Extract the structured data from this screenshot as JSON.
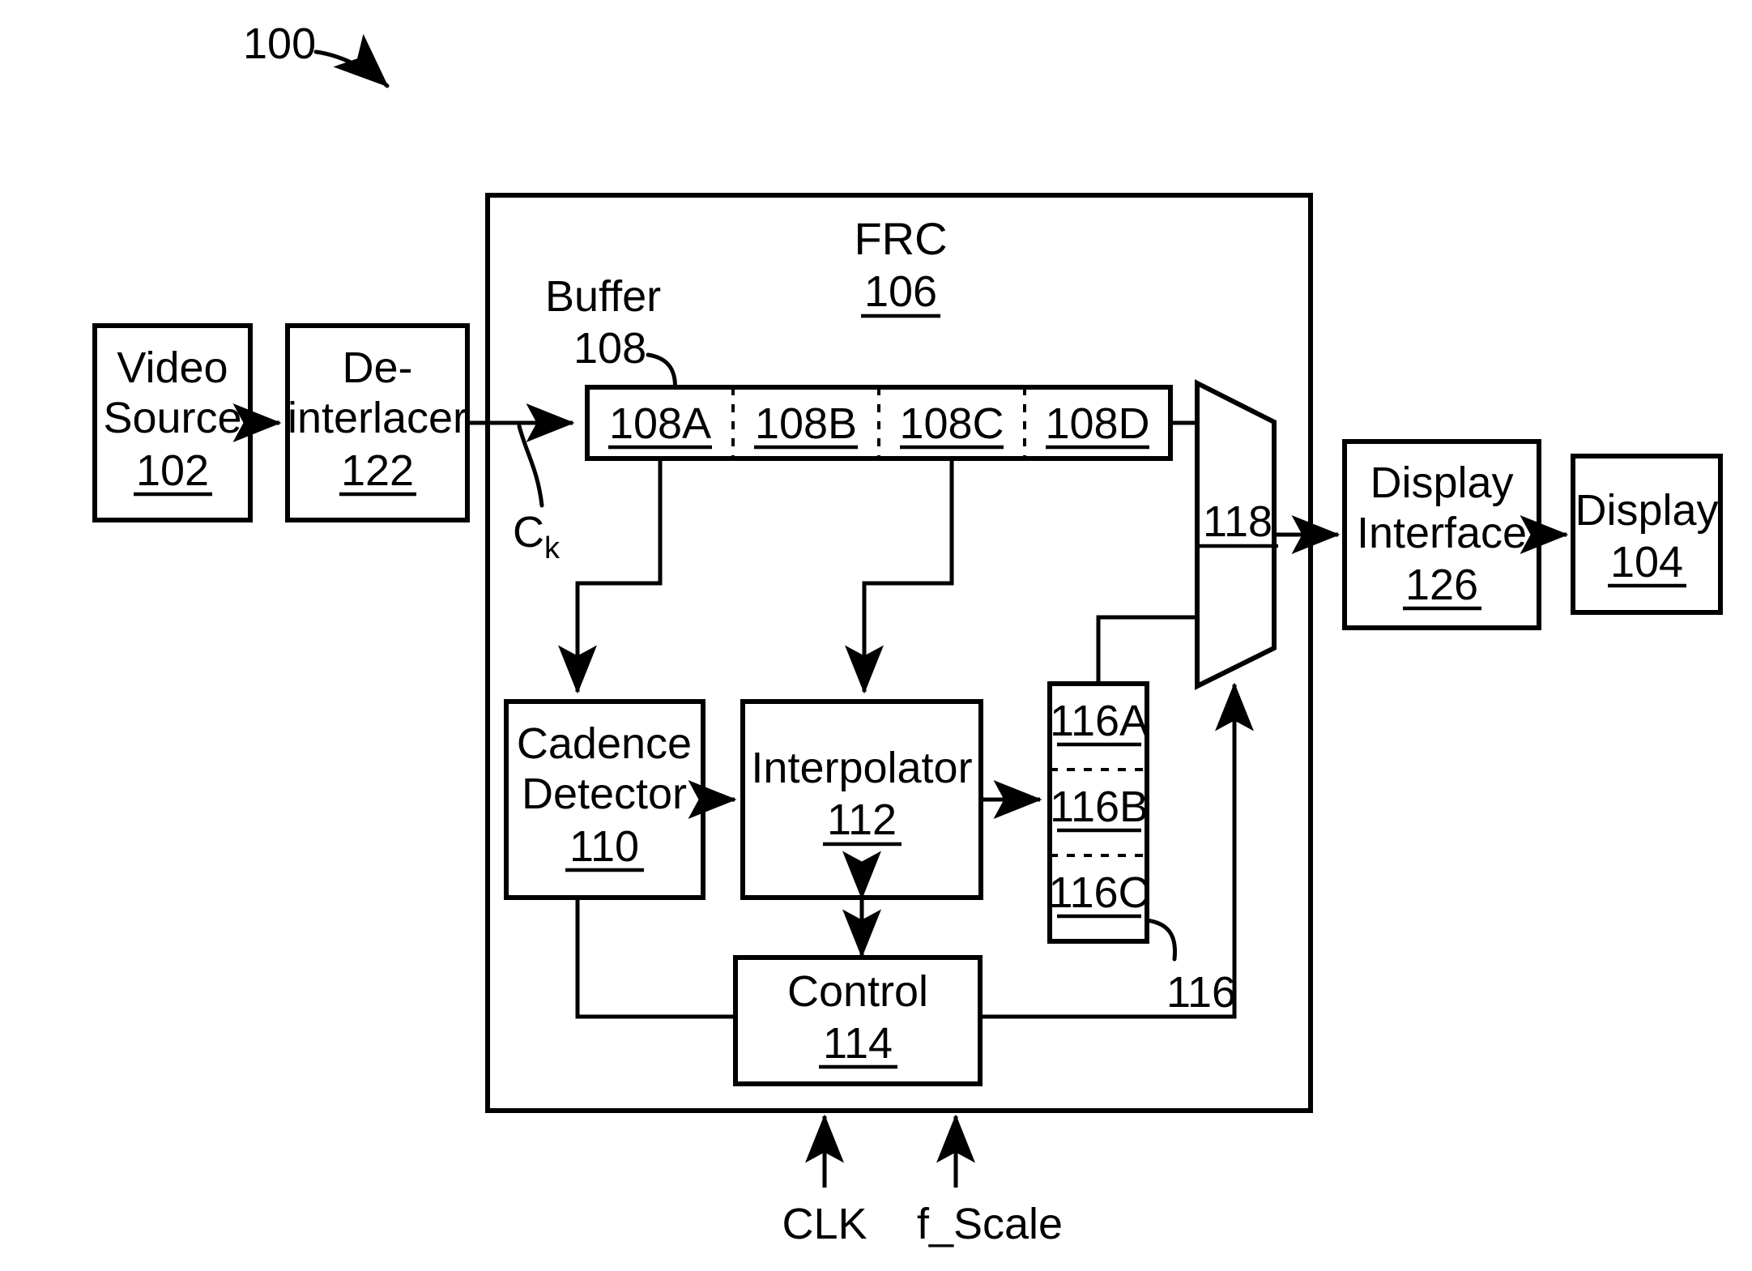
{
  "figure": {
    "figure_ref": "100",
    "title_note": "Frame rate converter block diagram"
  },
  "blocks": {
    "video_source": {
      "name": "video-source",
      "line1": "Video",
      "line2": "Source",
      "ref": "102"
    },
    "deinterlacer": {
      "name": "de-interlacer",
      "line1": "De-",
      "line2": "interlacer",
      "ref": "122"
    },
    "frc": {
      "name": "frc",
      "label": "FRC",
      "ref": "106"
    },
    "buffer": {
      "name": "buffer",
      "label": "Buffer",
      "ref": "108",
      "cells": [
        {
          "ref": "108A"
        },
        {
          "ref": "108B"
        },
        {
          "ref": "108C"
        },
        {
          "ref": "108D"
        }
      ]
    },
    "cadence_detector": {
      "name": "cadence-detector",
      "line1": "Cadence",
      "line2": "Detector",
      "ref": "110"
    },
    "interpolator": {
      "name": "interpolator",
      "label": "Interpolator",
      "ref": "112"
    },
    "control": {
      "name": "control",
      "label": "Control",
      "ref": "114"
    },
    "frame_store": {
      "name": "frame-store",
      "ref": "116",
      "cells": [
        {
          "ref": "116A"
        },
        {
          "ref": "116B"
        },
        {
          "ref": "116C"
        }
      ]
    },
    "mux": {
      "name": "mux",
      "ref": "118"
    },
    "display_interface": {
      "name": "display-interface",
      "line1": "Display",
      "line2": "Interface",
      "ref": "126"
    },
    "display": {
      "name": "display",
      "label": "Display",
      "ref": "104"
    }
  },
  "signals": {
    "ck": {
      "base": "C",
      "sub": "k"
    },
    "clk": "CLK",
    "f_scale": "f_Scale"
  },
  "colors": {
    "stroke": "#000000",
    "fill": "#ffffff"
  }
}
